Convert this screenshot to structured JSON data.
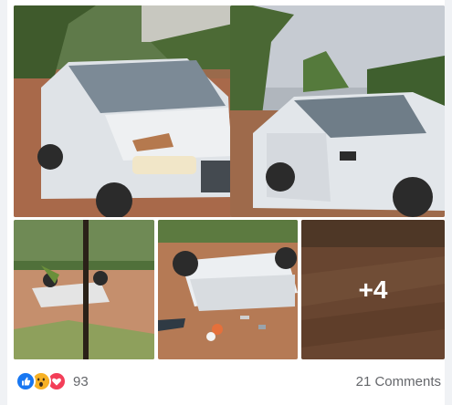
{
  "post": {
    "photos": [
      {
        "subject": "white ute with crushed roof on dirt road, front view"
      },
      {
        "subject": "white ute with crushed roof, side view"
      },
      {
        "subject": "upturned vehicle among trees"
      },
      {
        "subject": "vehicle on its roof beside debris"
      },
      {
        "subject": "dirt road"
      }
    ],
    "more_photos_label": "+4",
    "reactions": {
      "icons": [
        "like-icon",
        "wow-icon",
        "love-icon"
      ],
      "count": "93"
    },
    "comments_label": "21 Comments"
  },
  "colors": {
    "like": "#1877f2",
    "wow": "#f7b125",
    "love": "#f33e58",
    "meta_text": "#65676b"
  }
}
